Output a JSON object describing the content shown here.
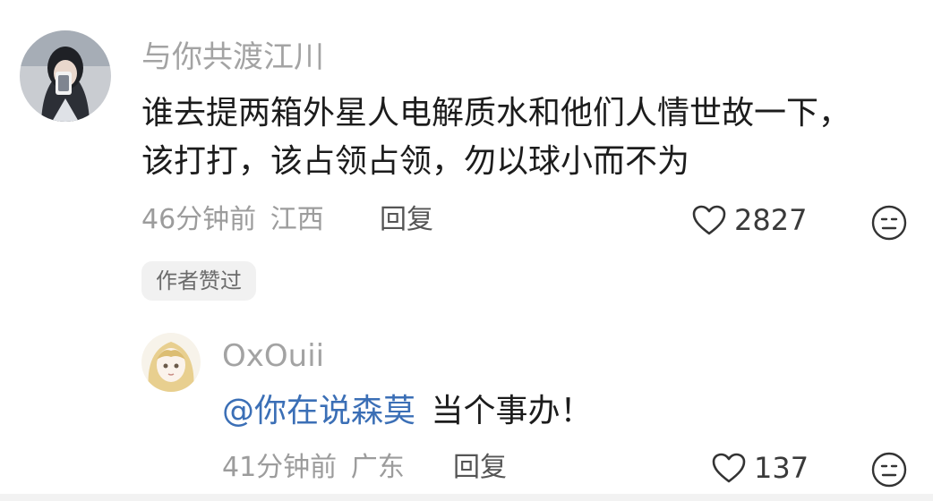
{
  "comment": {
    "username": "与你共渡江川",
    "text_line1": "谁去提两箱外星人电解质水和他们人情世故一下，",
    "text_line2": "该打打，该占领占领，勿以球小而不为",
    "time": "46分钟前",
    "location": "江西",
    "reply_label": "回复",
    "like_count": "2827",
    "badge": "作者赞过"
  },
  "reply": {
    "username": "OxOuii",
    "mention": "@你在说森莫",
    "text": "当个事办！",
    "time": "41分钟前",
    "location": "广东",
    "reply_label": "回复",
    "like_count": "137"
  },
  "icons": {
    "like": "heart-outline-icon",
    "dislike": "meh-face-icon"
  },
  "colors": {
    "mention": "#3b6fb6",
    "username": "#a3a3a3"
  }
}
